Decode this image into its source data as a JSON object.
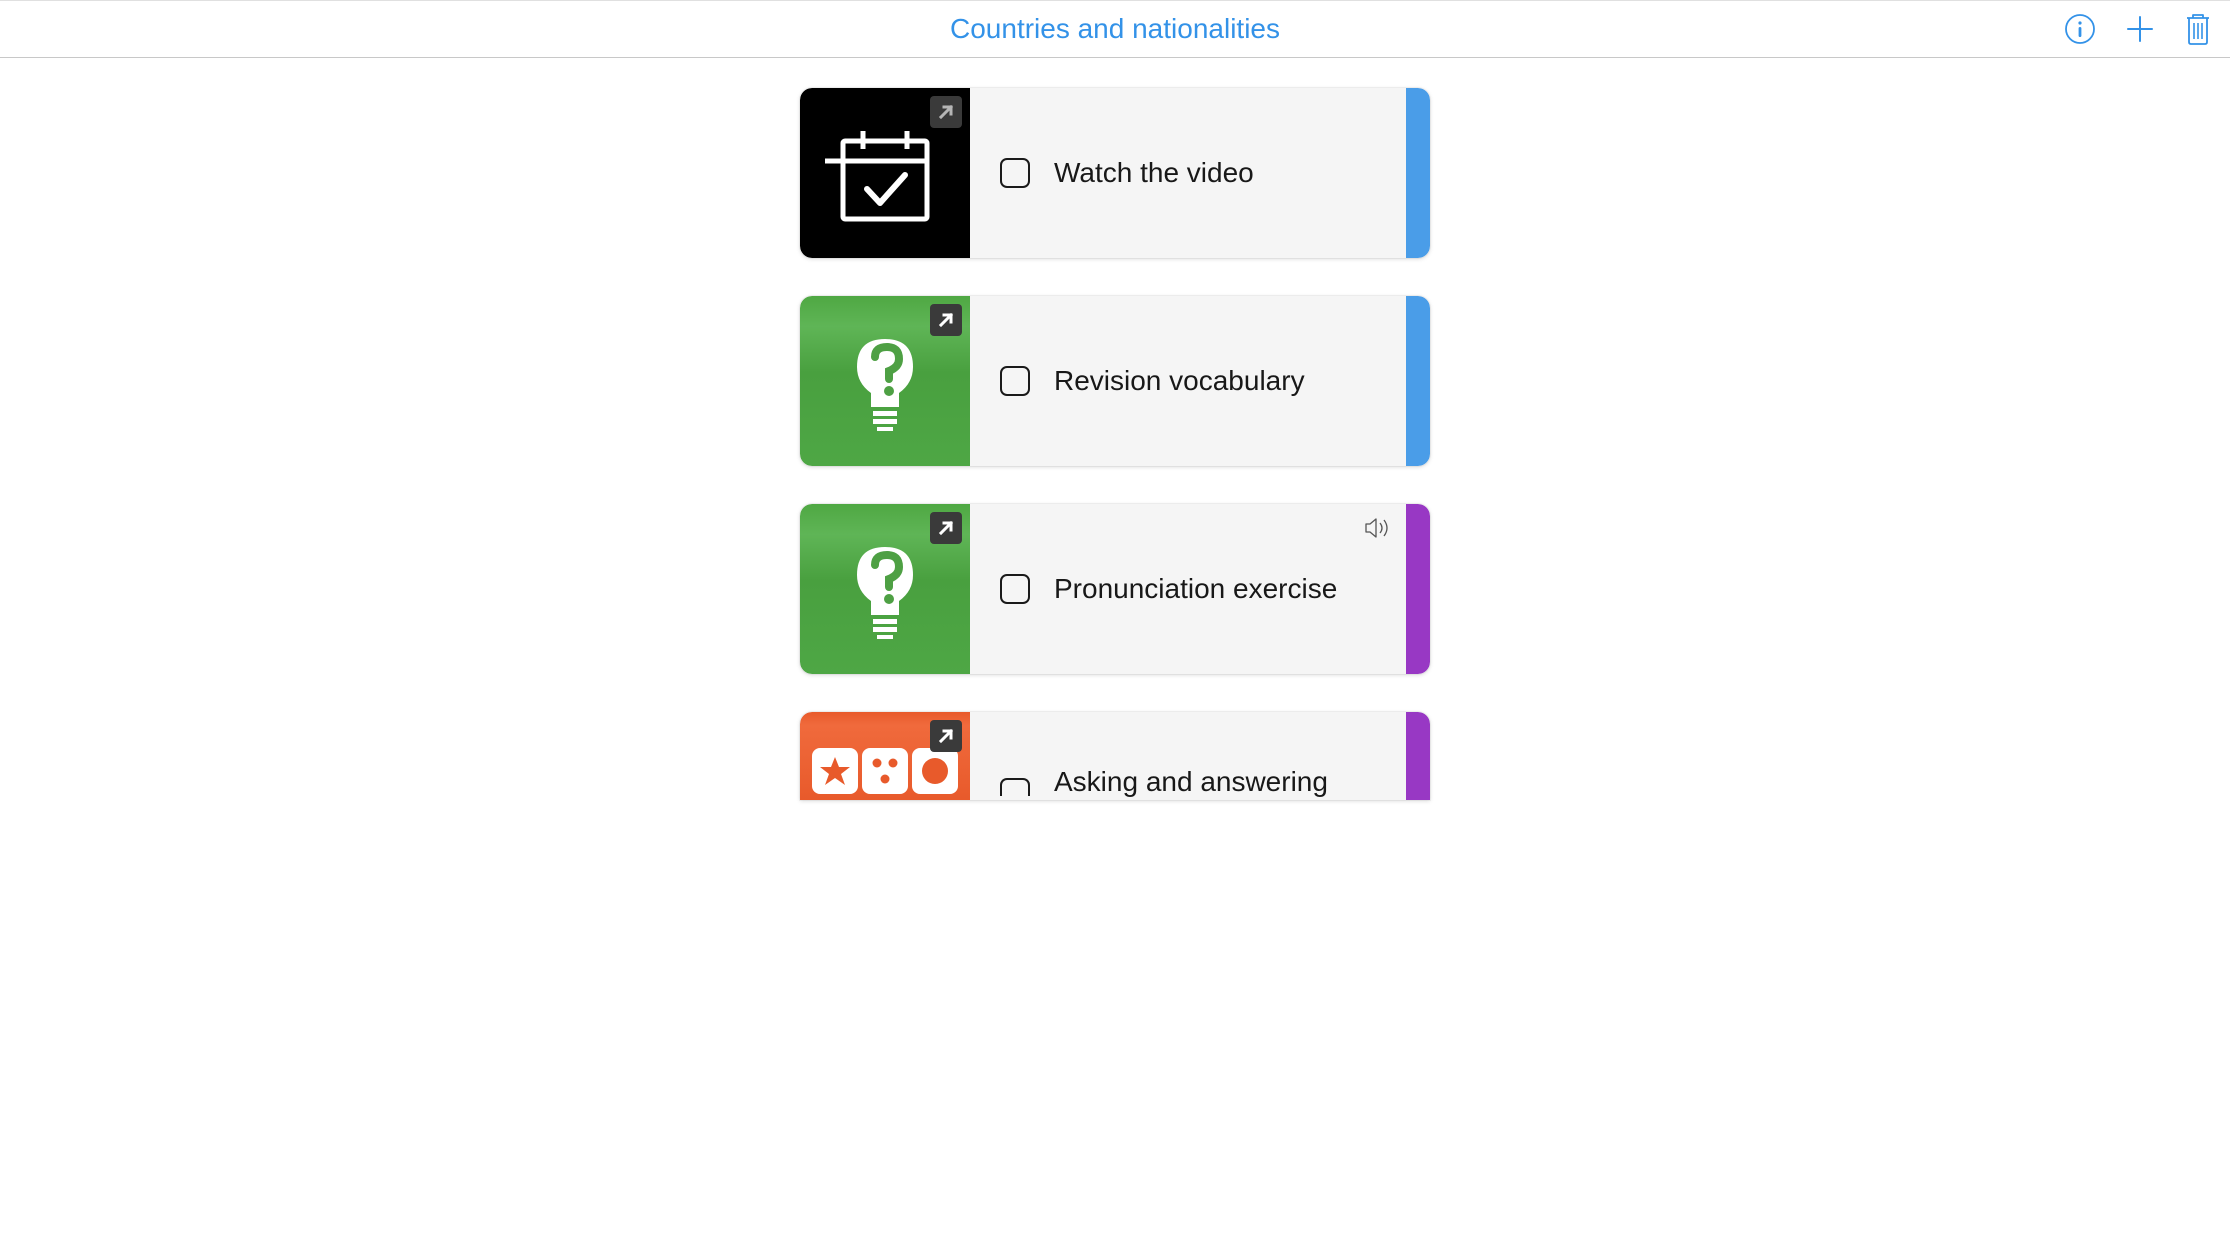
{
  "header": {
    "title": "Countries and nationalities"
  },
  "colors": {
    "accent": "#3392e8",
    "stripe_blue": "#4a9de8",
    "stripe_purple": "#9838c4"
  },
  "cards": [
    {
      "title": "Watch the video",
      "thumb_type": "calendar",
      "thumb_bg": "black",
      "stripe": "blue",
      "has_audio": false,
      "checked": false
    },
    {
      "title": "Revision vocabulary",
      "thumb_type": "lightbulb",
      "thumb_bg": "green",
      "stripe": "blue",
      "has_audio": false,
      "checked": false
    },
    {
      "title": "Pronunciation exercise",
      "thumb_type": "lightbulb",
      "thumb_bg": "green",
      "stripe": "purple",
      "has_audio": true,
      "checked": false
    },
    {
      "title": "Asking and answering",
      "thumb_type": "game",
      "thumb_bg": "orange",
      "stripe": "purple",
      "has_audio": false,
      "checked": false
    }
  ]
}
